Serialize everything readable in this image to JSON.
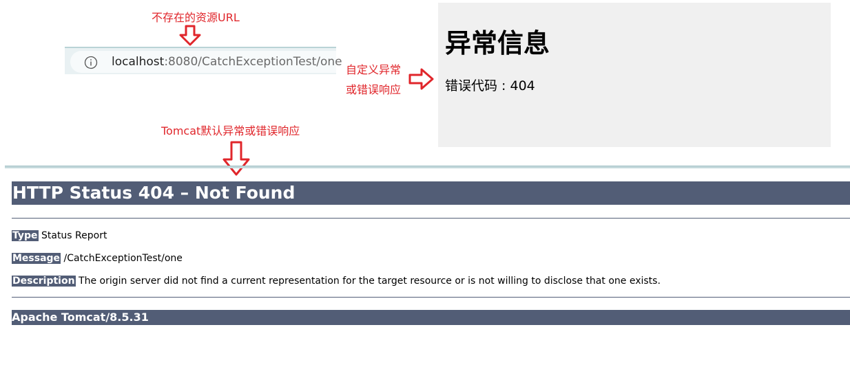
{
  "annotations": {
    "nonexistent_url": "不存在的资源URL",
    "custom_line1": "自定义异常",
    "custom_line2": "或错误响应",
    "tomcat_default": "Tomcat默认异常或错误响应",
    "arrow_color": "#e0262b"
  },
  "address_bar": {
    "icon": "info-icon",
    "host": "localhost",
    "rest": ":8080/CatchExceptionTest/one"
  },
  "custom_page": {
    "title": "异常信息",
    "code_text": "错误代码 : 404",
    "background": "#f0f0f0"
  },
  "tomcat_page": {
    "title": "HTTP Status 404 – Not Found",
    "type_label": "Type",
    "type_value": "Status Report",
    "message_label": "Message",
    "message_value": "/CatchExceptionTest/one",
    "description_label": "Description",
    "description_value": "The origin server did not find a current representation for the target resource or is not willing to disclose that one exists.",
    "footer": "Apache Tomcat/8.5.31",
    "accent": "#525d76"
  }
}
